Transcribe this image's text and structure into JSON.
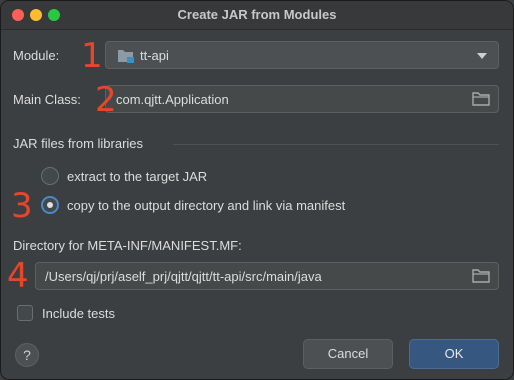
{
  "window": {
    "title": "Create JAR from Modules"
  },
  "module": {
    "label": "Module:",
    "value": "tt-api"
  },
  "main_class": {
    "label": "Main Class:",
    "value": "com.qjtt.Application"
  },
  "jar_libraries": {
    "section_title": "JAR files from libraries",
    "options": [
      {
        "label": "extract to the target JAR",
        "selected": false
      },
      {
        "label": "copy to the output directory and link via manifest",
        "selected": true
      }
    ]
  },
  "manifest_dir": {
    "label": "Directory for META-INF/MANIFEST.MF:",
    "value": "/Users/qj/prj/aself_prj/qjtt/qjtt/tt-api/src/main/java"
  },
  "include_tests": {
    "label": "Include tests",
    "checked": false
  },
  "buttons": {
    "help": "?",
    "cancel": "Cancel",
    "ok": "OK"
  },
  "annotations": [
    "1",
    "2",
    "3",
    "4"
  ],
  "colors": {
    "accent": "#365880",
    "annotation": "#e8462b",
    "background": "#3c3f41"
  }
}
